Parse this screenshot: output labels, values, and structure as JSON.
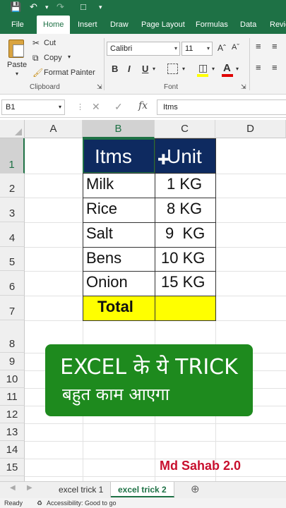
{
  "ribbon_tabs": [
    "File",
    "Home",
    "Insert",
    "Draw",
    "Page Layout",
    "Formulas",
    "Data",
    "Revie"
  ],
  "clipboard": {
    "paste": "Paste",
    "cut": "Cut",
    "copy": "Copy",
    "format_painter": "Format Painter",
    "group": "Clipboard"
  },
  "font": {
    "name": "Calibri",
    "size": "11",
    "group": "Font",
    "bold": "B",
    "italic": "I",
    "underline": "U"
  },
  "formula_bar": {
    "name_box": "B1",
    "content": "Itms"
  },
  "columns": [
    "A",
    "B",
    "C",
    "D"
  ],
  "rows": [
    "1",
    "2",
    "3",
    "4",
    "5",
    "6",
    "7",
    "8",
    "9",
    "10",
    "11",
    "12",
    "13",
    "14",
    "15"
  ],
  "table": {
    "header": [
      "Itms",
      "Unit"
    ],
    "items": [
      {
        "name": "Milk",
        "unit": "1 KG"
      },
      {
        "name": "Rice",
        "unit": "8 KG"
      },
      {
        "name": "Salt",
        "unit": "9  KG"
      },
      {
        "name": "Bens",
        "unit": "10 KG"
      },
      {
        "name": "Onion",
        "unit": "15 KG"
      }
    ],
    "total_label": "Total"
  },
  "banner": {
    "line1": "EXCEL के ये TRICK",
    "line2": "बहुत काम आएगा"
  },
  "watermark": "Md Sahab 2.0",
  "sheets": [
    "excel trick 1",
    "excel trick 2"
  ],
  "status": {
    "ready": "Ready",
    "accessibility": "Accessibility: Good to go"
  },
  "colors": {
    "excel_green": "#1e7145",
    "header_fill": "#0e2a60",
    "total_fill": "#ffff00",
    "banner_fill": "#1e8a1e",
    "watermark": "#c8102e"
  }
}
